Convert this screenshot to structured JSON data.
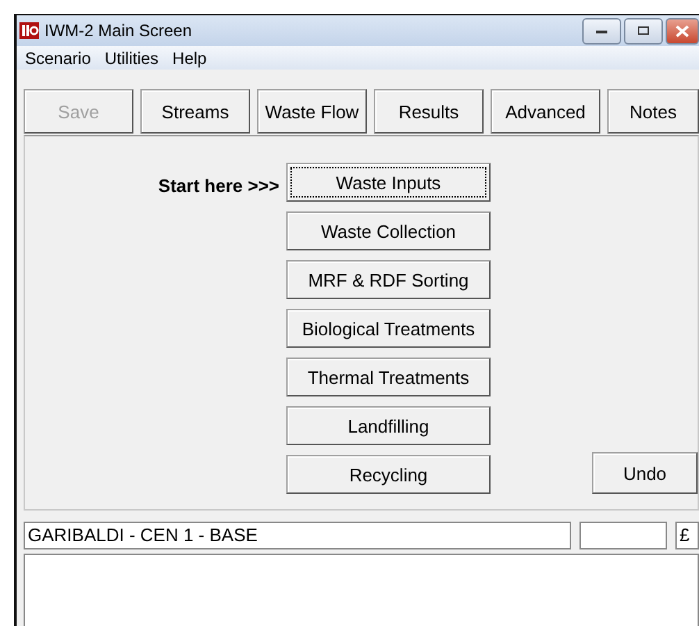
{
  "window": {
    "title": "IWM-2 Main Screen"
  },
  "menu": [
    "Scenario",
    "Utilities",
    "Help"
  ],
  "toolbar": [
    {
      "label": "Save",
      "disabled": true
    },
    {
      "label": "Streams",
      "disabled": false
    },
    {
      "label": "Waste Flow",
      "disabled": false
    },
    {
      "label": "Results",
      "disabled": false
    },
    {
      "label": "Advanced",
      "disabled": false
    },
    {
      "label": "Notes",
      "disabled": false
    }
  ],
  "start_label": "Start here >>>",
  "stages": [
    {
      "label": "Waste Inputs",
      "focused": true
    },
    {
      "label": "Waste Collection",
      "focused": false
    },
    {
      "label": "MRF & RDF Sorting",
      "focused": false
    },
    {
      "label": "Biological Treatments",
      "focused": false
    },
    {
      "label": "Thermal Treatments",
      "focused": false
    },
    {
      "label": "Landfilling",
      "focused": false
    },
    {
      "label": "Recycling",
      "focused": false
    }
  ],
  "undo_button": "Undo",
  "scenario_field": {
    "value": "GARIBALDI - CEN 1 - BASE"
  },
  "currency_field": {
    "value": "£"
  }
}
